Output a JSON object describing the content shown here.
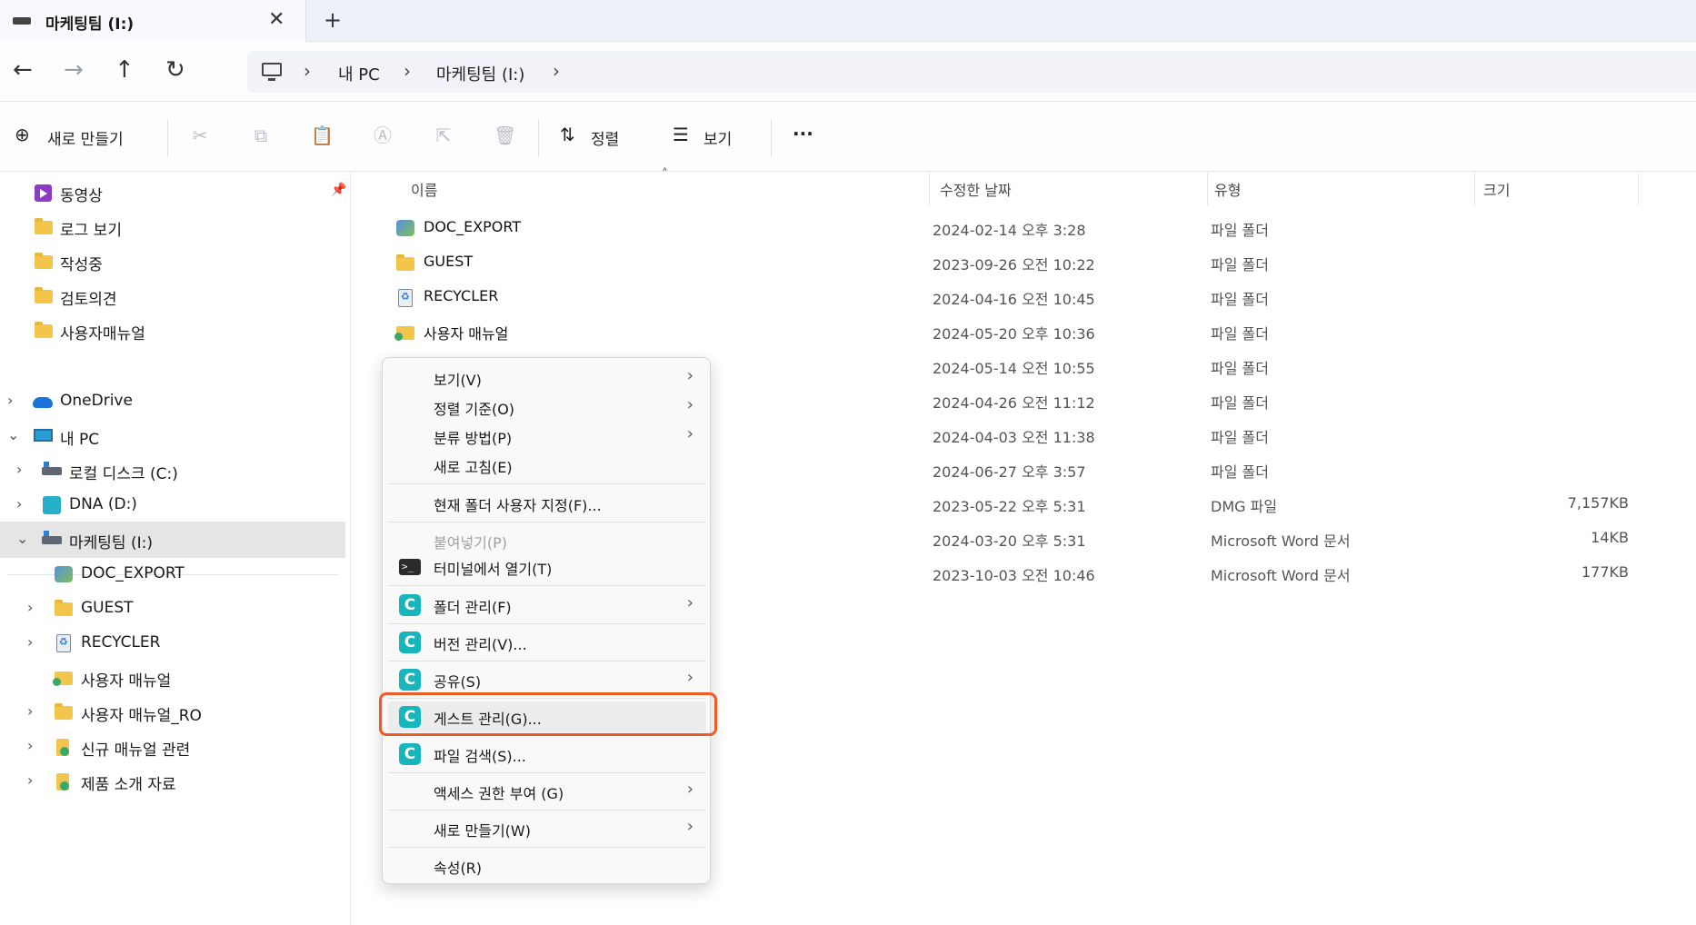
{
  "window": {
    "tab_title": "마케팅팀 (I:)",
    "close_glyph": "✕",
    "new_tab_glyph": "+"
  },
  "nav_buttons": {
    "back": "←",
    "forward": "→",
    "up": "↑",
    "refresh": "↻"
  },
  "breadcrumb": {
    "items": [
      "내 PC",
      "마케팅팀 (I:)"
    ],
    "separator": "›"
  },
  "toolbar": {
    "new_label": "새로 만들기",
    "new_glyph": "⊕",
    "sort_label": "정렬",
    "sort_glyph": "⇅",
    "view_label": "보기",
    "view_glyph": "☰",
    "more_glyph": "···",
    "action_icons": [
      "cut-icon",
      "copy-icon",
      "paste-icon",
      "rename-icon",
      "share-icon",
      "delete-icon"
    ]
  },
  "sidebar": {
    "quick_access": [
      {
        "label": "동영상",
        "icon": "video-icon"
      },
      {
        "label": "로그 보기",
        "icon": "folder-icon"
      },
      {
        "label": "작성중",
        "icon": "folder-icon"
      },
      {
        "label": "검토의견",
        "icon": "folder-icon"
      },
      {
        "label": "사용자매뉴얼",
        "icon": "folder-icon"
      }
    ],
    "pin_glyph": "📌",
    "tree": [
      {
        "label": "OneDrive",
        "icon": "onedrive-icon",
        "arrow": "›"
      },
      {
        "label": "내 PC",
        "icon": "pc-icon",
        "arrow": "⌄"
      },
      {
        "label": "로컬 디스크 (C:)",
        "icon": "drive-icon",
        "arrow": "›"
      },
      {
        "label": "DNA (D:)",
        "icon": "dna-drive-icon",
        "arrow": "›"
      },
      {
        "label": "마케팅팀 (I:)",
        "icon": "drive-icon",
        "arrow": "⌄"
      },
      {
        "label": "DOC_EXPORT",
        "icon": "export-folder-icon",
        "arrow": ""
      },
      {
        "label": "GUEST",
        "icon": "folder-icon",
        "arrow": "›"
      },
      {
        "label": "RECYCLER",
        "icon": "recycler-icon",
        "arrow": "›"
      },
      {
        "label": "사용자 매뉴얼",
        "icon": "shared-folder-icon",
        "arrow": ""
      },
      {
        "label": "사용자 매뉴얼_RO",
        "icon": "folder-icon",
        "arrow": "›"
      },
      {
        "label": "신규 매뉴얼 관련",
        "icon": "sync-folder-icon",
        "arrow": "›"
      },
      {
        "label": "제품 소개 자료",
        "icon": "sync-folder-icon",
        "arrow": "›"
      }
    ]
  },
  "columns": {
    "name": "이름",
    "date": "수정한 날짜",
    "type": "유형",
    "size": "크기",
    "sort_caret": "˄"
  },
  "files": [
    {
      "name": "DOC_EXPORT",
      "date": "2024-02-14 오후 3:28",
      "type": "파일 폴더",
      "size": "",
      "icon": "export-folder-icon"
    },
    {
      "name": "GUEST",
      "date": "2023-09-26 오전 10:22",
      "type": "파일 폴더",
      "size": "",
      "icon": "folder-icon"
    },
    {
      "name": "RECYCLER",
      "date": "2024-04-16 오전 10:45",
      "type": "파일 폴더",
      "size": "",
      "icon": "recycler-icon"
    },
    {
      "name": "사용자 매뉴얼",
      "date": "2024-05-20 오후 10:36",
      "type": "파일 폴더",
      "size": "",
      "icon": "shared-folder-icon"
    },
    {
      "name": "",
      "date": "2024-05-14 오전 10:55",
      "type": "파일 폴더",
      "size": ""
    },
    {
      "name": "",
      "date": "2024-04-26 오전 11:12",
      "type": "파일 폴더",
      "size": ""
    },
    {
      "name": "",
      "date": "2024-04-03 오전 11:38",
      "type": "파일 폴더",
      "size": ""
    },
    {
      "name": "",
      "date": "2024-06-27 오후 3:57",
      "type": "파일 폴더",
      "size": ""
    },
    {
      "name": "",
      "date": "2023-05-22 오후 5:31",
      "type": "DMG 파일",
      "size": "7,157KB"
    },
    {
      "name": "",
      "date": "2024-03-20 오후 5:31",
      "type": "Microsoft Word 문서",
      "size": "14KB"
    },
    {
      "name": "",
      "date": "2023-10-03 오전 10:46",
      "type": "Microsoft Word 문서",
      "size": "177KB"
    }
  ],
  "context_menu": {
    "items": [
      {
        "label": "보기(V)",
        "submenu": true
      },
      {
        "label": "정렬 기준(O)",
        "submenu": true
      },
      {
        "label": "분류 방법(P)",
        "submenu": true
      },
      {
        "label": "새로 고침(E)",
        "submenu": false
      },
      {
        "label": "현재 폴더 사용자 지정(F)...",
        "submenu": false
      },
      {
        "label": "붙여넣기(P)",
        "submenu": false,
        "disabled": true
      },
      {
        "label": "터미널에서 열기(T)",
        "submenu": false,
        "icon": "terminal-icon"
      },
      {
        "label": "폴더 관리(F)",
        "submenu": true,
        "icon": "c-app-icon"
      },
      {
        "label": "버전 관리(V)...",
        "submenu": false,
        "icon": "c-app-icon"
      },
      {
        "label": "공유(S)",
        "submenu": true,
        "icon": "c-app-icon"
      },
      {
        "label": "게스트 관리(G)...",
        "submenu": false,
        "icon": "c-app-icon",
        "highlighted": true
      },
      {
        "label": "파일 검색(S)...",
        "submenu": false,
        "icon": "c-app-icon"
      },
      {
        "label": "액세스 권한 부여 (G)",
        "submenu": true
      },
      {
        "label": "새로 만들기(W)",
        "submenu": true
      },
      {
        "label": "속성(R)",
        "submenu": false
      }
    ],
    "submenu_glyph": "›",
    "c_glyph": "C",
    "terminal_glyph": ">_"
  },
  "colors": {
    "highlight_border": "#f05a24",
    "c_app_icon": "#17b6bd",
    "selected_nav": "#e5e5e5"
  }
}
